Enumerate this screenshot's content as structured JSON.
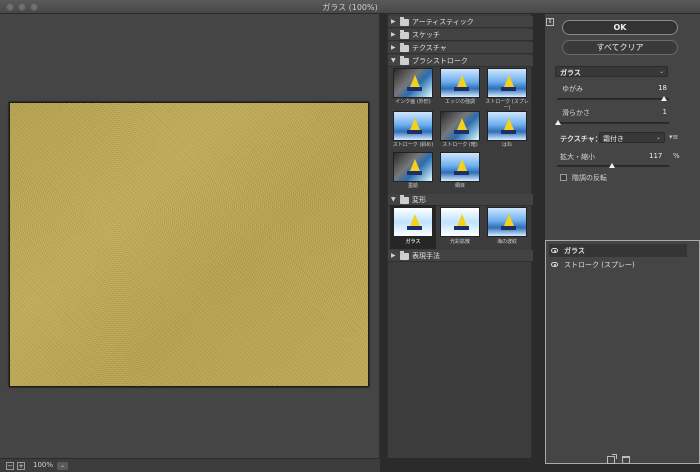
{
  "window": {
    "title": "ガラス (100%)"
  },
  "preview": {
    "zoom": "100%",
    "zoom_out": "−",
    "zoom_in": "+"
  },
  "gallery": {
    "folders": [
      {
        "label": "アーティスティック",
        "expanded": false
      },
      {
        "label": "スケッチ",
        "expanded": false
      },
      {
        "label": "テクスチャ",
        "expanded": false
      },
      {
        "label": "ブラシストローク",
        "expanded": true
      },
      {
        "label": "変形",
        "expanded": true
      },
      {
        "label": "表現手法",
        "expanded": false
      }
    ],
    "brush_strokes": [
      "インク画 (外形)",
      "エッジの強調",
      "ストローク (スプレー)",
      "ストローク (斜め)",
      "ストローク (暗)",
      "はね",
      "墨絵",
      "網目"
    ],
    "distort": [
      "ガラス",
      "光彩拡散",
      "海の波紋"
    ],
    "selected": "ガラス"
  },
  "controls": {
    "ok_label": "OK",
    "clear_label": "すべてクリア",
    "filter": "ガラス",
    "distortion": {
      "label": "ゆがみ",
      "value": "18"
    },
    "smoothness": {
      "label": "滑らかさ",
      "value": "1"
    },
    "texture": {
      "label": "テクスチャ：",
      "value": "霜付き"
    },
    "scaling": {
      "label": "拡大・縮小",
      "value": "117",
      "unit": "%"
    },
    "invert": {
      "label": "階調の反転",
      "checked": false
    }
  },
  "layers": [
    {
      "name": "ガラス",
      "visible": true,
      "active": true
    },
    {
      "name": "ストローク (スプレー)",
      "visible": true,
      "active": false
    }
  ]
}
